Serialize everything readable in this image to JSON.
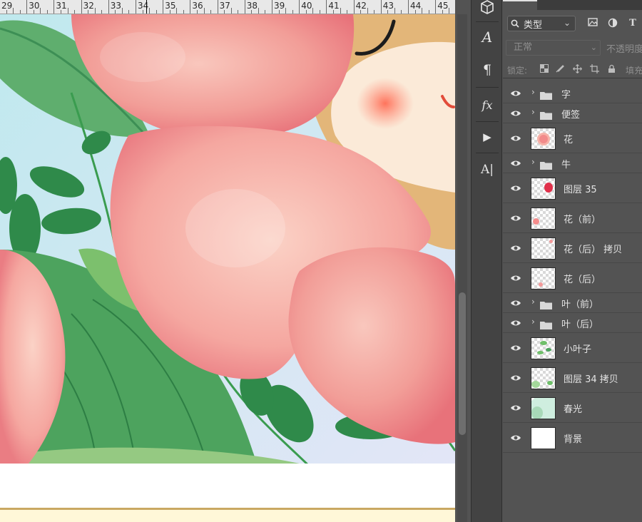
{
  "ruler": {
    "labels": [
      "29",
      "30",
      "31",
      "32",
      "33",
      "34",
      "35",
      "36",
      "37",
      "38",
      "39",
      "40",
      "41",
      "42",
      "43",
      "44",
      "45"
    ]
  },
  "toolbar": {
    "buttons": [
      {
        "name": "3d-icon",
        "glyph": "⬡"
      },
      {
        "name": "character-icon",
        "glyph": "A"
      },
      {
        "name": "paragraph-icon",
        "glyph": "¶"
      },
      {
        "name": "fx-icon",
        "glyph": "fx"
      },
      {
        "name": "actions-play-icon",
        "glyph": "▶"
      },
      {
        "name": "glyphs-icon",
        "glyph": "A|"
      }
    ]
  },
  "layers_panel": {
    "filter": {
      "label": "类型",
      "search_icon": "search-icon",
      "chevron": "⌄"
    },
    "filter_icons": [
      "image-filter-icon",
      "adjustment-filter-icon",
      "type-filter-icon"
    ],
    "blend_mode": "正常",
    "opacity_label": "不透明度",
    "lock_label": "锁定:",
    "fill_label": "填充",
    "layers": [
      {
        "name": "字",
        "kind": "group"
      },
      {
        "name": "便签",
        "kind": "group"
      },
      {
        "name": "花",
        "kind": "pixel",
        "thumb": "flower"
      },
      {
        "name": "牛",
        "kind": "group"
      },
      {
        "name": "图层 35",
        "kind": "pixel",
        "thumb": "red-blob"
      },
      {
        "name": "花（前）",
        "kind": "pixel",
        "thumb": "pink-dot"
      },
      {
        "name": "花（后） 拷贝",
        "kind": "pixel",
        "thumb": "pink-dot-small"
      },
      {
        "name": "花（后）",
        "kind": "pixel",
        "thumb": "pink-dot-low"
      },
      {
        "name": "叶（前）",
        "kind": "group"
      },
      {
        "name": "叶（后）",
        "kind": "group"
      },
      {
        "name": "小叶子",
        "kind": "pixel",
        "thumb": "leaves"
      },
      {
        "name": "图层 34 拷贝",
        "kind": "pixel",
        "thumb": "leaves-corner"
      },
      {
        "name": "春光",
        "kind": "pixel",
        "thumb": "spring-light"
      },
      {
        "name": "背景",
        "kind": "pixel",
        "thumb": "white"
      }
    ]
  },
  "colors": {
    "panel_bg": "#535353",
    "tool_bg": "#434343",
    "peach": "#f28f8e",
    "peach_light": "#f7b5ae",
    "leaf_dark": "#2f8a4a",
    "leaf_light": "#6fbf6a",
    "sky": "#cfeff0",
    "cow_fur": "#e0b073",
    "paper_line": "#c9a862"
  }
}
